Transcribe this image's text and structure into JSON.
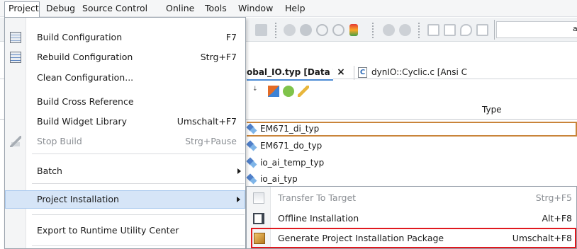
{
  "menubar": {
    "items": [
      "Project",
      "Debug",
      "Source Control",
      "Online",
      "Tools",
      "Window",
      "Help"
    ]
  },
  "editor": {
    "tabs": [
      {
        "label": "obal_IO.typ [Data Type Declaration]",
        "close": "×"
      },
      {
        "label": "dynIO::Cyclic.c [Ansi C"
      }
    ],
    "grid": {
      "type_header": "Type",
      "rows": [
        "EM671_di_typ",
        "EM671_do_typ",
        "io_ai_temp_typ",
        "io_ai_typ"
      ]
    },
    "toolbar_glyph": "a"
  },
  "project_menu": {
    "items": [
      {
        "label": "Build Configuration",
        "shortcut": "F7",
        "icon": "build-config-icon",
        "enabled": true
      },
      {
        "label": "Rebuild Configuration",
        "shortcut": "Strg+F7",
        "icon": "rebuild-config-icon",
        "enabled": true
      },
      {
        "label": "Clean Configuration...",
        "shortcut": "",
        "enabled": true
      },
      {
        "label": "Build Cross Reference",
        "shortcut": "",
        "enabled": true
      },
      {
        "label": "Build Widget Library",
        "shortcut": "Umschalt+F7",
        "enabled": true
      },
      {
        "label": "Stop Build",
        "shortcut": "Strg+Pause",
        "icon": "stop-build-icon",
        "enabled": false
      },
      {
        "label": "Batch",
        "shortcut": "",
        "enabled": true,
        "submenu": true
      },
      {
        "label": "Project Installation",
        "shortcut": "",
        "enabled": true,
        "submenu": true,
        "hovered": true
      },
      {
        "label": "Export to Runtime Utility Center",
        "shortcut": "",
        "enabled": true
      }
    ]
  },
  "install_submenu": {
    "items": [
      {
        "label": "Transfer To Target",
        "shortcut": "Strg+F5",
        "icon": "transfer-icon",
        "enabled": false
      },
      {
        "label": "Offline Installation",
        "shortcut": "Alt+F8",
        "icon": "offline-install-icon",
        "enabled": true
      },
      {
        "label": "Generate Project Installation Package",
        "shortcut": "Umschalt+F8",
        "icon": "package-icon",
        "enabled": true,
        "highlighted": true
      }
    ],
    "highlight_color": "#e0191f"
  }
}
